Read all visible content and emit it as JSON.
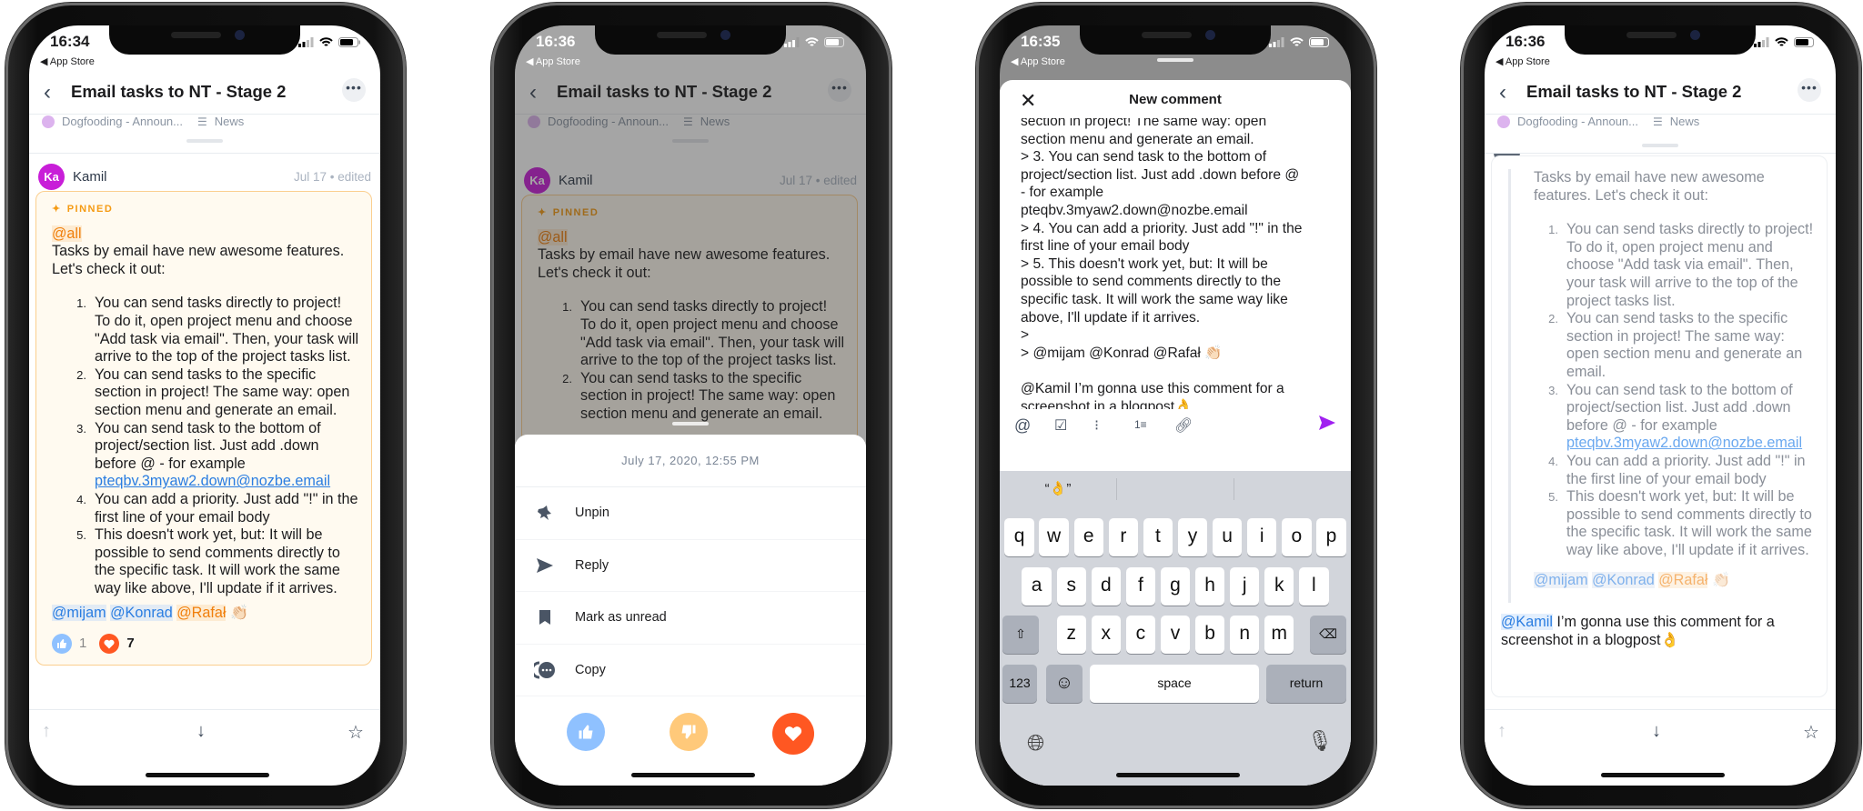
{
  "status_bar": {
    "back_app": "◀ App Store",
    "times": [
      "16:34",
      "16:36",
      "16:35",
      "16:36"
    ]
  },
  "header": {
    "title": "Email tasks to NT - Stage 2",
    "back_icon": "chevron-left-icon",
    "more_icon": "ellipsis-icon"
  },
  "breadcrumb": {
    "project": "Dogfooding - Announ...",
    "section": "News",
    "project_color": "#dcb3ee"
  },
  "comment": {
    "author": "Kamil",
    "avatar_initials": "Ka",
    "avatar_color": "#c81ed8",
    "date": "Jul 17 • edited",
    "pinned_label": "PINNED",
    "mention_all": "@all",
    "intro": "Tasks by email have new awesome features. Let's check it out:",
    "items": [
      {
        "n": "1.",
        "text": "You can send tasks directly to project! To do it, open project menu and choose \"Add task via email\". Then, your task will arrive to the top of the project tasks list."
      },
      {
        "n": "2.",
        "text": "You can send tasks to the specific section in project! The same way: open section menu and generate an email."
      },
      {
        "n": "3.",
        "text": "You can send task to the bottom of project/section list. Just add .down before @ - for example ",
        "link": "pteqbv.3myaw2.down@nozbe.email"
      },
      {
        "n": "4.",
        "text": "You can add a priority. Just add \"!\" in the first line of your email body"
      },
      {
        "n": "5.",
        "text": "This doesn't work yet, but: It will be possible to send comments directly to the specific task. It will work the same way like above, I'll update if it arrives."
      }
    ],
    "mentions": [
      "@mijam",
      "@Konrad",
      "@Rafał"
    ],
    "clap_emoji": "👏🏻",
    "reactions": [
      {
        "icon": "thumbs-up-icon",
        "count": "1",
        "color": "#8fc1ff"
      },
      {
        "icon": "heart-icon",
        "count": "7",
        "color": "#ff5722"
      }
    ]
  },
  "action_sheet": {
    "date": "July 17, 2020, 12:55 PM",
    "actions": [
      {
        "label": "Unpin",
        "icon": "pin-icon"
      },
      {
        "label": "Reply",
        "icon": "send-icon"
      },
      {
        "label": "Mark as unread",
        "icon": "bookmark-icon"
      },
      {
        "label": "Copy",
        "icon": "copy-icon"
      }
    ],
    "reactions": [
      {
        "icon": "thumbs-up-icon",
        "color": "#8fc1ff"
      },
      {
        "icon": "thumbs-down-icon",
        "color": "#ffc97a"
      },
      {
        "icon": "heart-icon",
        "color": "#ff5722"
      }
    ]
  },
  "composer": {
    "title": "New comment",
    "lines": [
      "section in project! The same way: open",
      "section menu and generate an email.",
      "> 3. You can send task to the bottom of",
      "project/section list. Just add .down before @",
      "- for example",
      "pteqbv.3myaw2.down@nozbe.email",
      "> 4. You can add a priority. Just add \"!\" in the",
      "first line of your email body",
      "> 5. This doesn't work yet, but: It will be",
      "possible to send comments directly to the",
      "specific task. It will work the same way like",
      "above, I'll update if it arrives.",
      ">",
      "> @mijam @Konrad @Rafał 👏🏻",
      "",
      " @Kamil I’m gonna use this comment for a",
      "screenshot in a blogpost👌"
    ],
    "format_icons": [
      "at-icon",
      "checklist-icon",
      "bullet-list-icon",
      "numbered-list-icon",
      "link-icon"
    ],
    "send_color": "#a020f0"
  },
  "keyboard": {
    "suggestions": [
      "“👌”",
      "",
      ""
    ],
    "rows": [
      [
        "q",
        "w",
        "e",
        "r",
        "t",
        "y",
        "u",
        "i",
        "o",
        "p"
      ],
      [
        "a",
        "s",
        "d",
        "f",
        "g",
        "h",
        "j",
        "k",
        "l"
      ],
      [
        "z",
        "x",
        "c",
        "v",
        "b",
        "n",
        "m"
      ]
    ],
    "numbers": "123",
    "space": "space",
    "return": "return"
  },
  "reply": {
    "mention": "@Kamil",
    "text": " I’m gonna use this comment for a screenshot in a blogpost",
    "emoji": "👌"
  }
}
